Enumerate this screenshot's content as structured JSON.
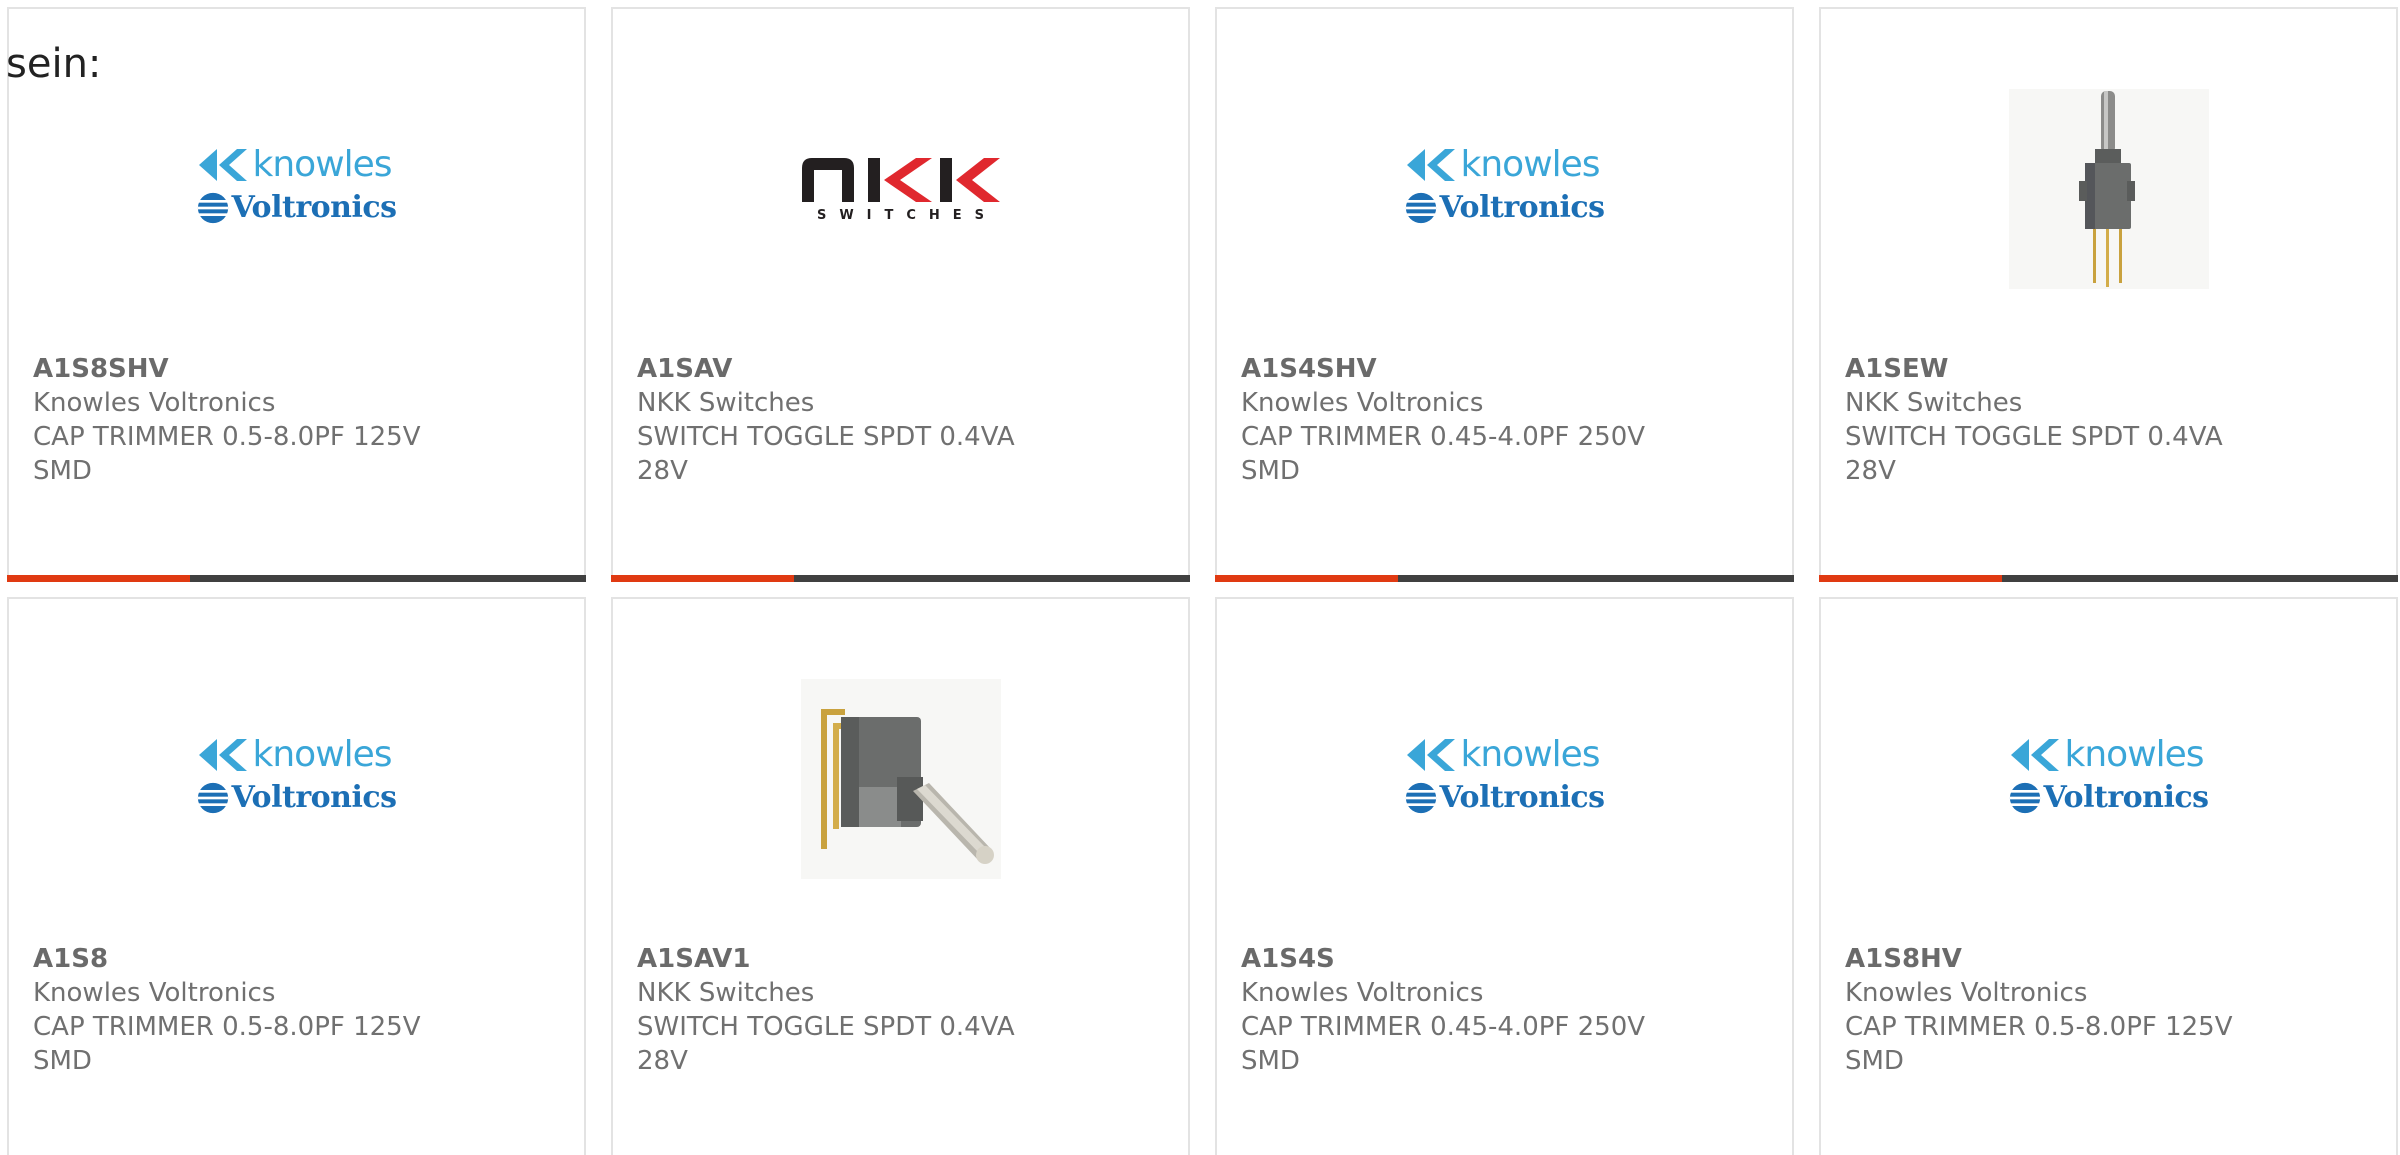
{
  "intro_text": "sein:",
  "logos": {
    "knowles_text": "knowles",
    "voltronics_text": "Voltronics",
    "nkk_sub": "SWITCHES"
  },
  "colors": {
    "accent_bar": "#e03a12",
    "bar_dark": "#404040",
    "knowles_blue": "#3aa6d8",
    "voltronics_blue": "#1c6fb5"
  },
  "products": [
    {
      "part": "A1S8SHV",
      "manufacturer": "Knowles Voltronics",
      "desc1": "CAP TRIMMER 0.5-8.0PF 125V",
      "desc2": "SMD",
      "image": "knowles-voltronics-logo"
    },
    {
      "part": "A1SAV",
      "manufacturer": "NKK Switches",
      "desc1": "SWITCH TOGGLE SPDT 0.4VA",
      "desc2": "28V",
      "image": "nkk-switches-logo"
    },
    {
      "part": "A1S4SHV",
      "manufacturer": "Knowles Voltronics",
      "desc1": "CAP TRIMMER 0.45-4.0PF 250V",
      "desc2": "SMD",
      "image": "knowles-voltronics-logo"
    },
    {
      "part": "A1SEW",
      "manufacturer": "NKK Switches",
      "desc1": "SWITCH TOGGLE SPDT 0.4VA",
      "desc2": "28V",
      "image": "vertical-toggle-switch-photo"
    },
    {
      "part": "A1S8",
      "manufacturer": "Knowles Voltronics",
      "desc1": "CAP TRIMMER 0.5-8.0PF 125V",
      "desc2": "SMD",
      "image": "knowles-voltronics-logo"
    },
    {
      "part": "A1SAV1",
      "manufacturer": "NKK Switches",
      "desc1": "SWITCH TOGGLE SPDT 0.4VA",
      "desc2": "28V",
      "image": "right-angle-toggle-switch-photo"
    },
    {
      "part": "A1S4S",
      "manufacturer": "Knowles Voltronics",
      "desc1": "CAP TRIMMER 0.45-4.0PF 250V",
      "desc2": "SMD",
      "image": "knowles-voltronics-logo"
    },
    {
      "part": "A1S8HV",
      "manufacturer": "Knowles Voltronics",
      "desc1": "CAP TRIMMER 0.5-8.0PF 125V",
      "desc2": "SMD",
      "image": "knowles-voltronics-logo"
    }
  ]
}
